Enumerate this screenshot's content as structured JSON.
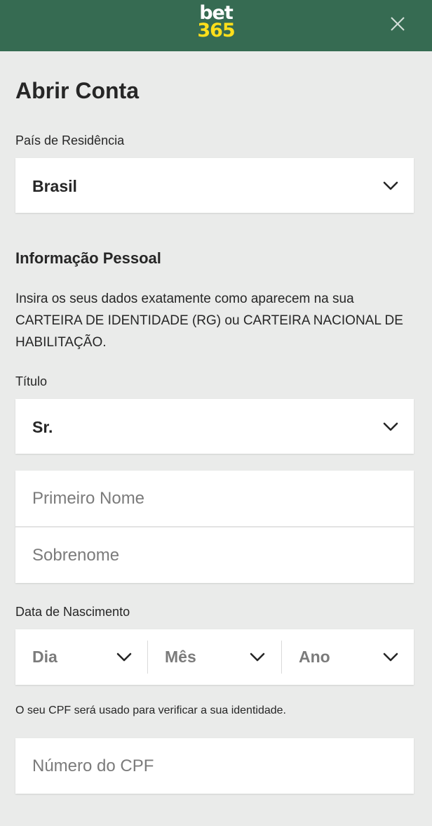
{
  "header": {
    "logo_top": "bet",
    "logo_bottom": "365"
  },
  "page_title": "Abrir Conta",
  "country": {
    "label": "País de Residência",
    "value": "Brasil"
  },
  "personal": {
    "section_title": "Informação Pessoal",
    "intro": "Insira os seus dados exatamente como aparecem na sua CARTEIRA DE IDENTIDADE (RG) ou CARTEIRA NACIONAL DE HABILITAÇÃO.",
    "title_label": "Título",
    "title_value": "Sr.",
    "first_name_placeholder": "Primeiro Nome",
    "last_name_placeholder": "Sobrenome"
  },
  "dob": {
    "label": "Data de Nascimento",
    "day": "Dia",
    "month": "Mês",
    "year": "Ano"
  },
  "cpf": {
    "note": "O seu CPF será usado para verificar a sua identidade.",
    "placeholder": "Número do CPF"
  },
  "colors": {
    "header_bg": "#366b52",
    "logo_yellow": "#ffdf1b",
    "page_bg": "#eaebea"
  },
  "icons": [
    "close-icon",
    "chevron-down-icon"
  ]
}
